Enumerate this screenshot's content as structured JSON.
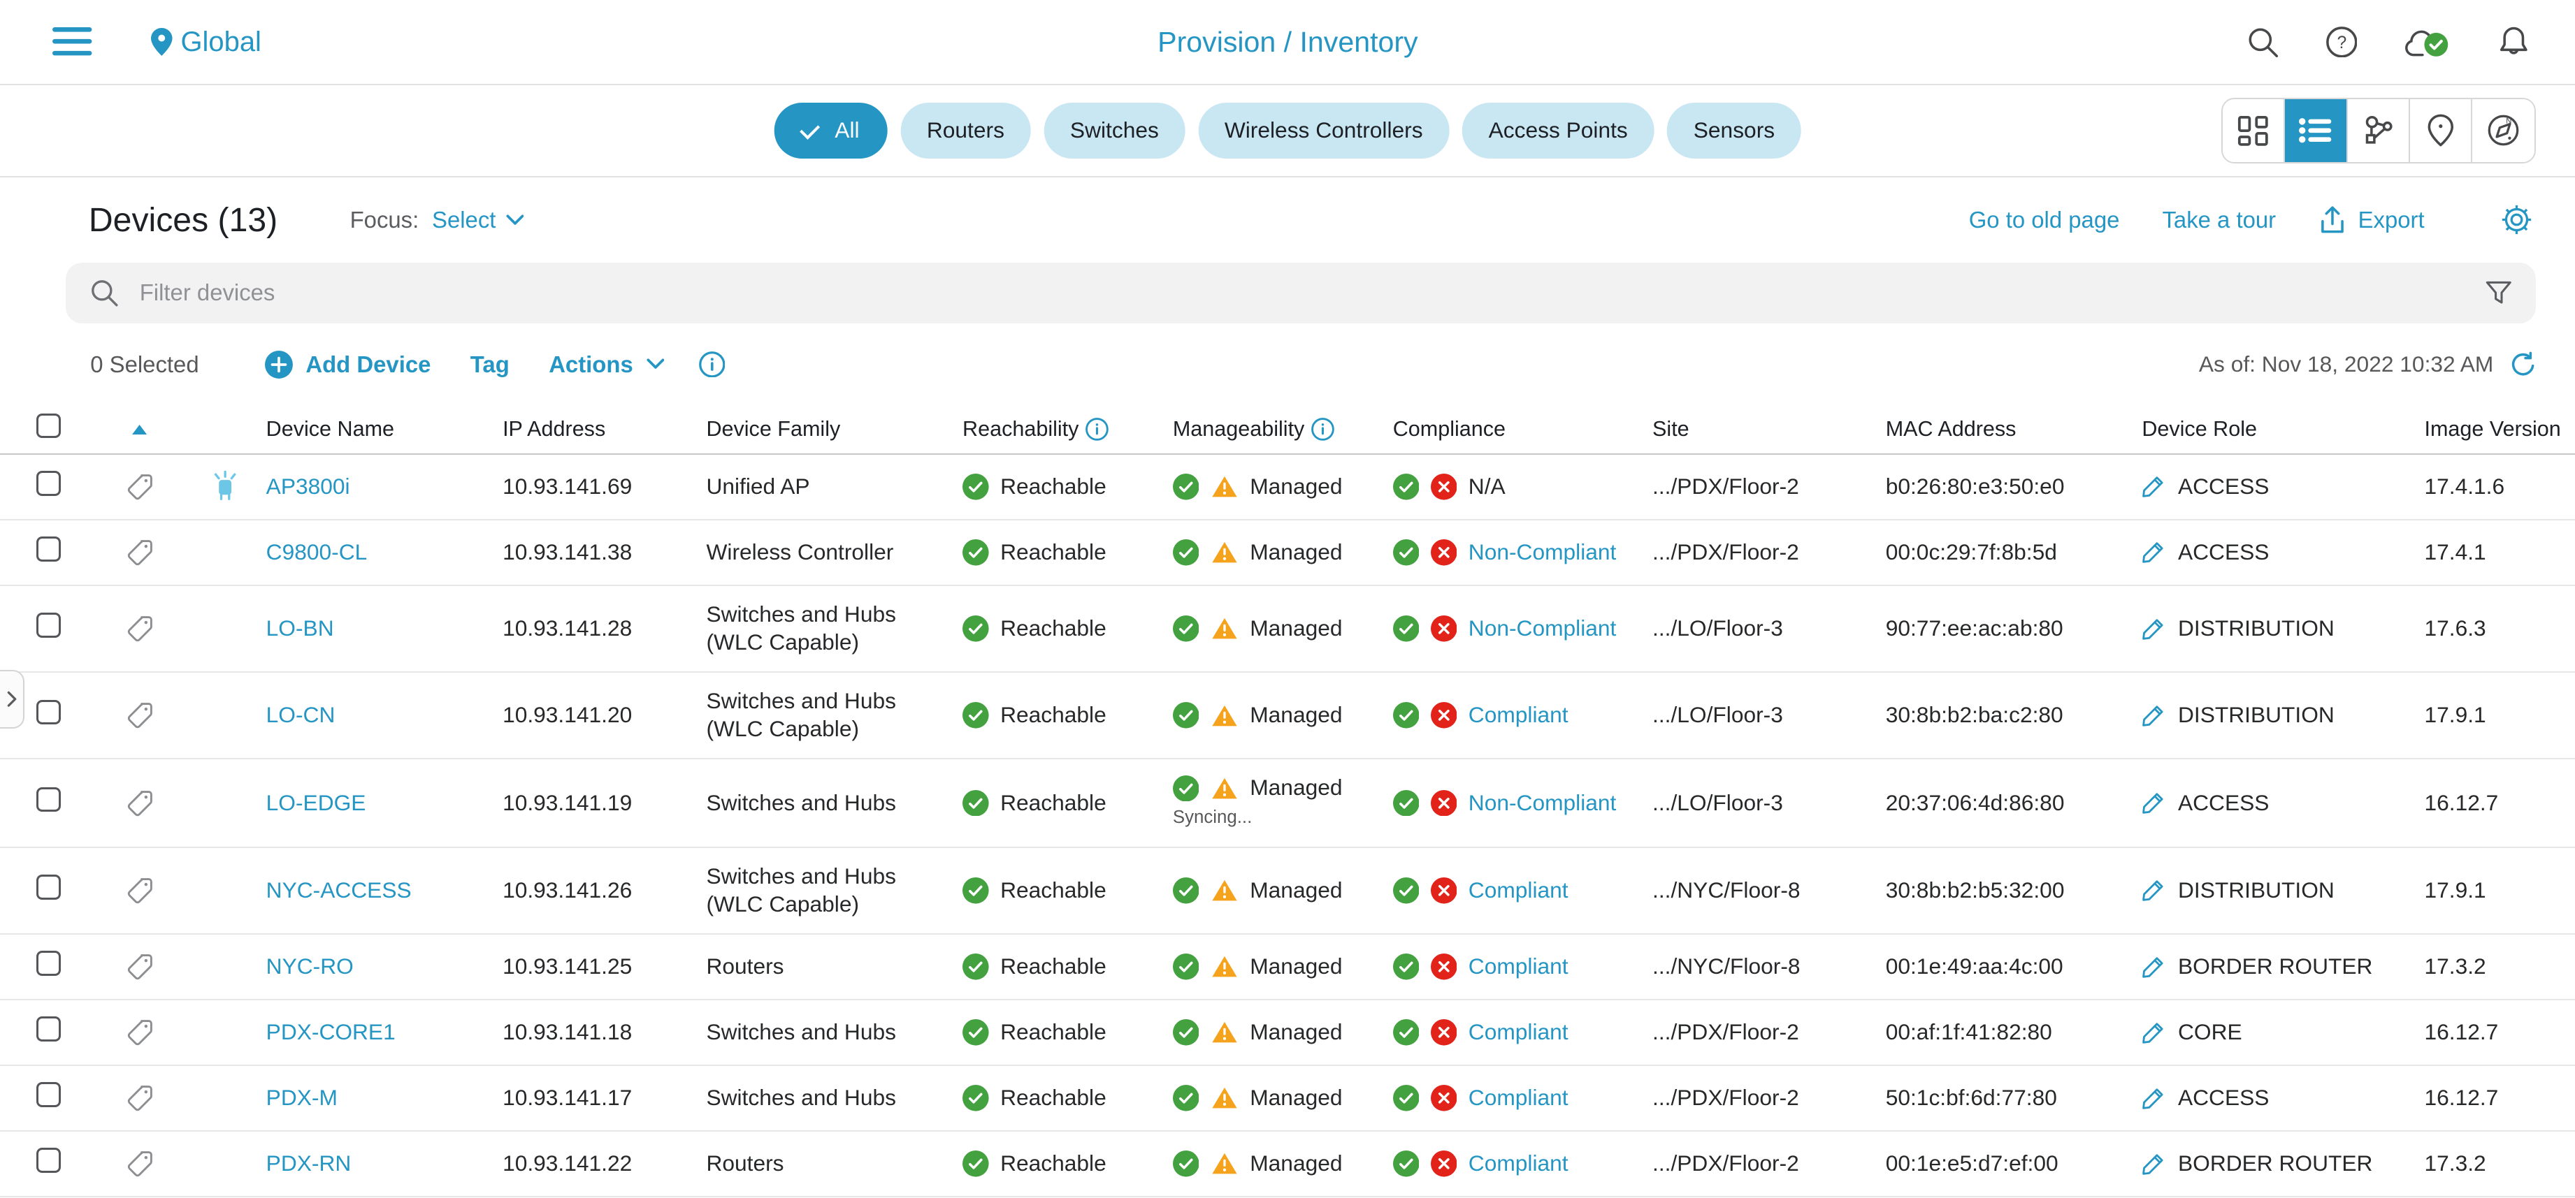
{
  "colors": {
    "accent": "#2596c4",
    "success": "#43a13f",
    "error": "#e2231a",
    "warning": "#f5a31c",
    "chip_bg": "#c9e7f3"
  },
  "topbar": {
    "location": "Global",
    "title": "Provision / Inventory"
  },
  "filter_chips": [
    {
      "label": "All",
      "selected": true
    },
    {
      "label": "Routers",
      "selected": false
    },
    {
      "label": "Switches",
      "selected": false
    },
    {
      "label": "Wireless Controllers",
      "selected": false
    },
    {
      "label": "Access Points",
      "selected": false
    },
    {
      "label": "Sensors",
      "selected": false
    }
  ],
  "view_toggles": [
    {
      "name": "grid-view",
      "active": false
    },
    {
      "name": "list-view",
      "active": true
    },
    {
      "name": "topology-view",
      "active": false
    },
    {
      "name": "map-view",
      "active": false
    },
    {
      "name": "geo-view",
      "active": false
    }
  ],
  "devices_header": {
    "title": "Devices (13)",
    "focus_label": "Focus:",
    "focus_value": "Select",
    "go_to_old_page": "Go to old page",
    "take_a_tour": "Take a tour",
    "export_label": "Export"
  },
  "search": {
    "placeholder": "Filter devices"
  },
  "toolbar": {
    "selected": "0 Selected",
    "add_device": "Add Device",
    "tag": "Tag",
    "actions": "Actions",
    "as_of": "As of: Nov 18, 2022 10:32 AM"
  },
  "table": {
    "columns": [
      "Device Name",
      "IP Address",
      "Device Family",
      "Reachability",
      "Manageability",
      "Compliance",
      "Site",
      "MAC Address",
      "Device Role",
      "Image Version"
    ],
    "rows": [
      {
        "name": "AP3800i",
        "beacon": true,
        "ip": "10.93.141.69",
        "family": "Unified AP",
        "reachability": "Reachable",
        "manageability": "Managed",
        "manageability_status": "ok",
        "manageability_sub": "",
        "compliance": "N/A",
        "compliance_status": "na",
        "site": ".../PDX/Floor-2",
        "mac": "b0:26:80:e3:50:e0",
        "role": "ACCESS",
        "version": "17.4.1.6"
      },
      {
        "name": "C9800-CL",
        "beacon": false,
        "ip": "10.93.141.38",
        "family": "Wireless Controller",
        "reachability": "Reachable",
        "manageability": "Managed",
        "manageability_status": "ok",
        "manageability_sub": "",
        "compliance": "Non-Compliant",
        "compliance_status": "error",
        "site": ".../PDX/Floor-2",
        "mac": "00:0c:29:7f:8b:5d",
        "role": "ACCESS",
        "version": "17.4.1"
      },
      {
        "name": "LO-BN",
        "beacon": false,
        "ip": "10.93.141.28",
        "family": "Switches and Hubs (WLC Capable)",
        "reachability": "Reachable",
        "manageability": "Managed",
        "manageability_status": "ok",
        "manageability_sub": "",
        "compliance": "Non-Compliant",
        "compliance_status": "error",
        "site": ".../LO/Floor-3",
        "mac": "90:77:ee:ac:ab:80",
        "role": "DISTRIBUTION",
        "version": "17.6.3"
      },
      {
        "name": "LO-CN",
        "beacon": false,
        "ip": "10.93.141.20",
        "family": "Switches and Hubs (WLC Capable)",
        "reachability": "Reachable",
        "manageability": "Managed",
        "manageability_status": "ok",
        "manageability_sub": "",
        "compliance": "Compliant",
        "compliance_status": "ok",
        "site": ".../LO/Floor-3",
        "mac": "30:8b:b2:ba:c2:80",
        "role": "DISTRIBUTION",
        "version": "17.9.1"
      },
      {
        "name": "LO-EDGE",
        "beacon": false,
        "ip": "10.93.141.19",
        "family": "Switches and Hubs",
        "reachability": "Reachable",
        "manageability": "Managed",
        "manageability_status": "warning",
        "manageability_sub": "Syncing...",
        "compliance": "Non-Compliant",
        "compliance_status": "error",
        "site": ".../LO/Floor-3",
        "mac": "20:37:06:4d:86:80",
        "role": "ACCESS",
        "version": "16.12.7"
      },
      {
        "name": "NYC-ACCESS",
        "beacon": false,
        "ip": "10.93.141.26",
        "family": "Switches and Hubs (WLC Capable)",
        "reachability": "Reachable",
        "manageability": "Managed",
        "manageability_status": "ok",
        "manageability_sub": "",
        "compliance": "Compliant",
        "compliance_status": "ok",
        "site": ".../NYC/Floor-8",
        "mac": "30:8b:b2:b5:32:00",
        "role": "DISTRIBUTION",
        "version": "17.9.1"
      },
      {
        "name": "NYC-RO",
        "beacon": false,
        "ip": "10.93.141.25",
        "family": "Routers",
        "reachability": "Reachable",
        "manageability": "Managed",
        "manageability_status": "ok",
        "manageability_sub": "",
        "compliance": "Compliant",
        "compliance_status": "ok",
        "site": ".../NYC/Floor-8",
        "mac": "00:1e:49:aa:4c:00",
        "role": "BORDER ROUTER",
        "version": "17.3.2"
      },
      {
        "name": "PDX-CORE1",
        "beacon": false,
        "ip": "10.93.141.18",
        "family": "Switches and Hubs",
        "reachability": "Reachable",
        "manageability": "Managed",
        "manageability_status": "ok",
        "manageability_sub": "",
        "compliance": "Compliant",
        "compliance_status": "ok",
        "site": ".../PDX/Floor-2",
        "mac": "00:af:1f:41:82:80",
        "role": "CORE",
        "version": "16.12.7"
      },
      {
        "name": "PDX-M",
        "beacon": false,
        "ip": "10.93.141.17",
        "family": "Switches and Hubs",
        "reachability": "Reachable",
        "manageability": "Managed",
        "manageability_status": "ok",
        "manageability_sub": "",
        "compliance": "Compliant",
        "compliance_status": "ok",
        "site": ".../PDX/Floor-2",
        "mac": "50:1c:bf:6d:77:80",
        "role": "ACCESS",
        "version": "16.12.7"
      },
      {
        "name": "PDX-RN",
        "beacon": false,
        "ip": "10.93.141.22",
        "family": "Routers",
        "reachability": "Reachable",
        "manageability": "Managed",
        "manageability_status": "ok",
        "manageability_sub": "",
        "compliance": "Compliant",
        "compliance_status": "ok",
        "site": ".../PDX/Floor-2",
        "mac": "00:1e:e5:d7:ef:00",
        "role": "BORDER ROUTER",
        "version": "17.3.2"
      }
    ]
  }
}
